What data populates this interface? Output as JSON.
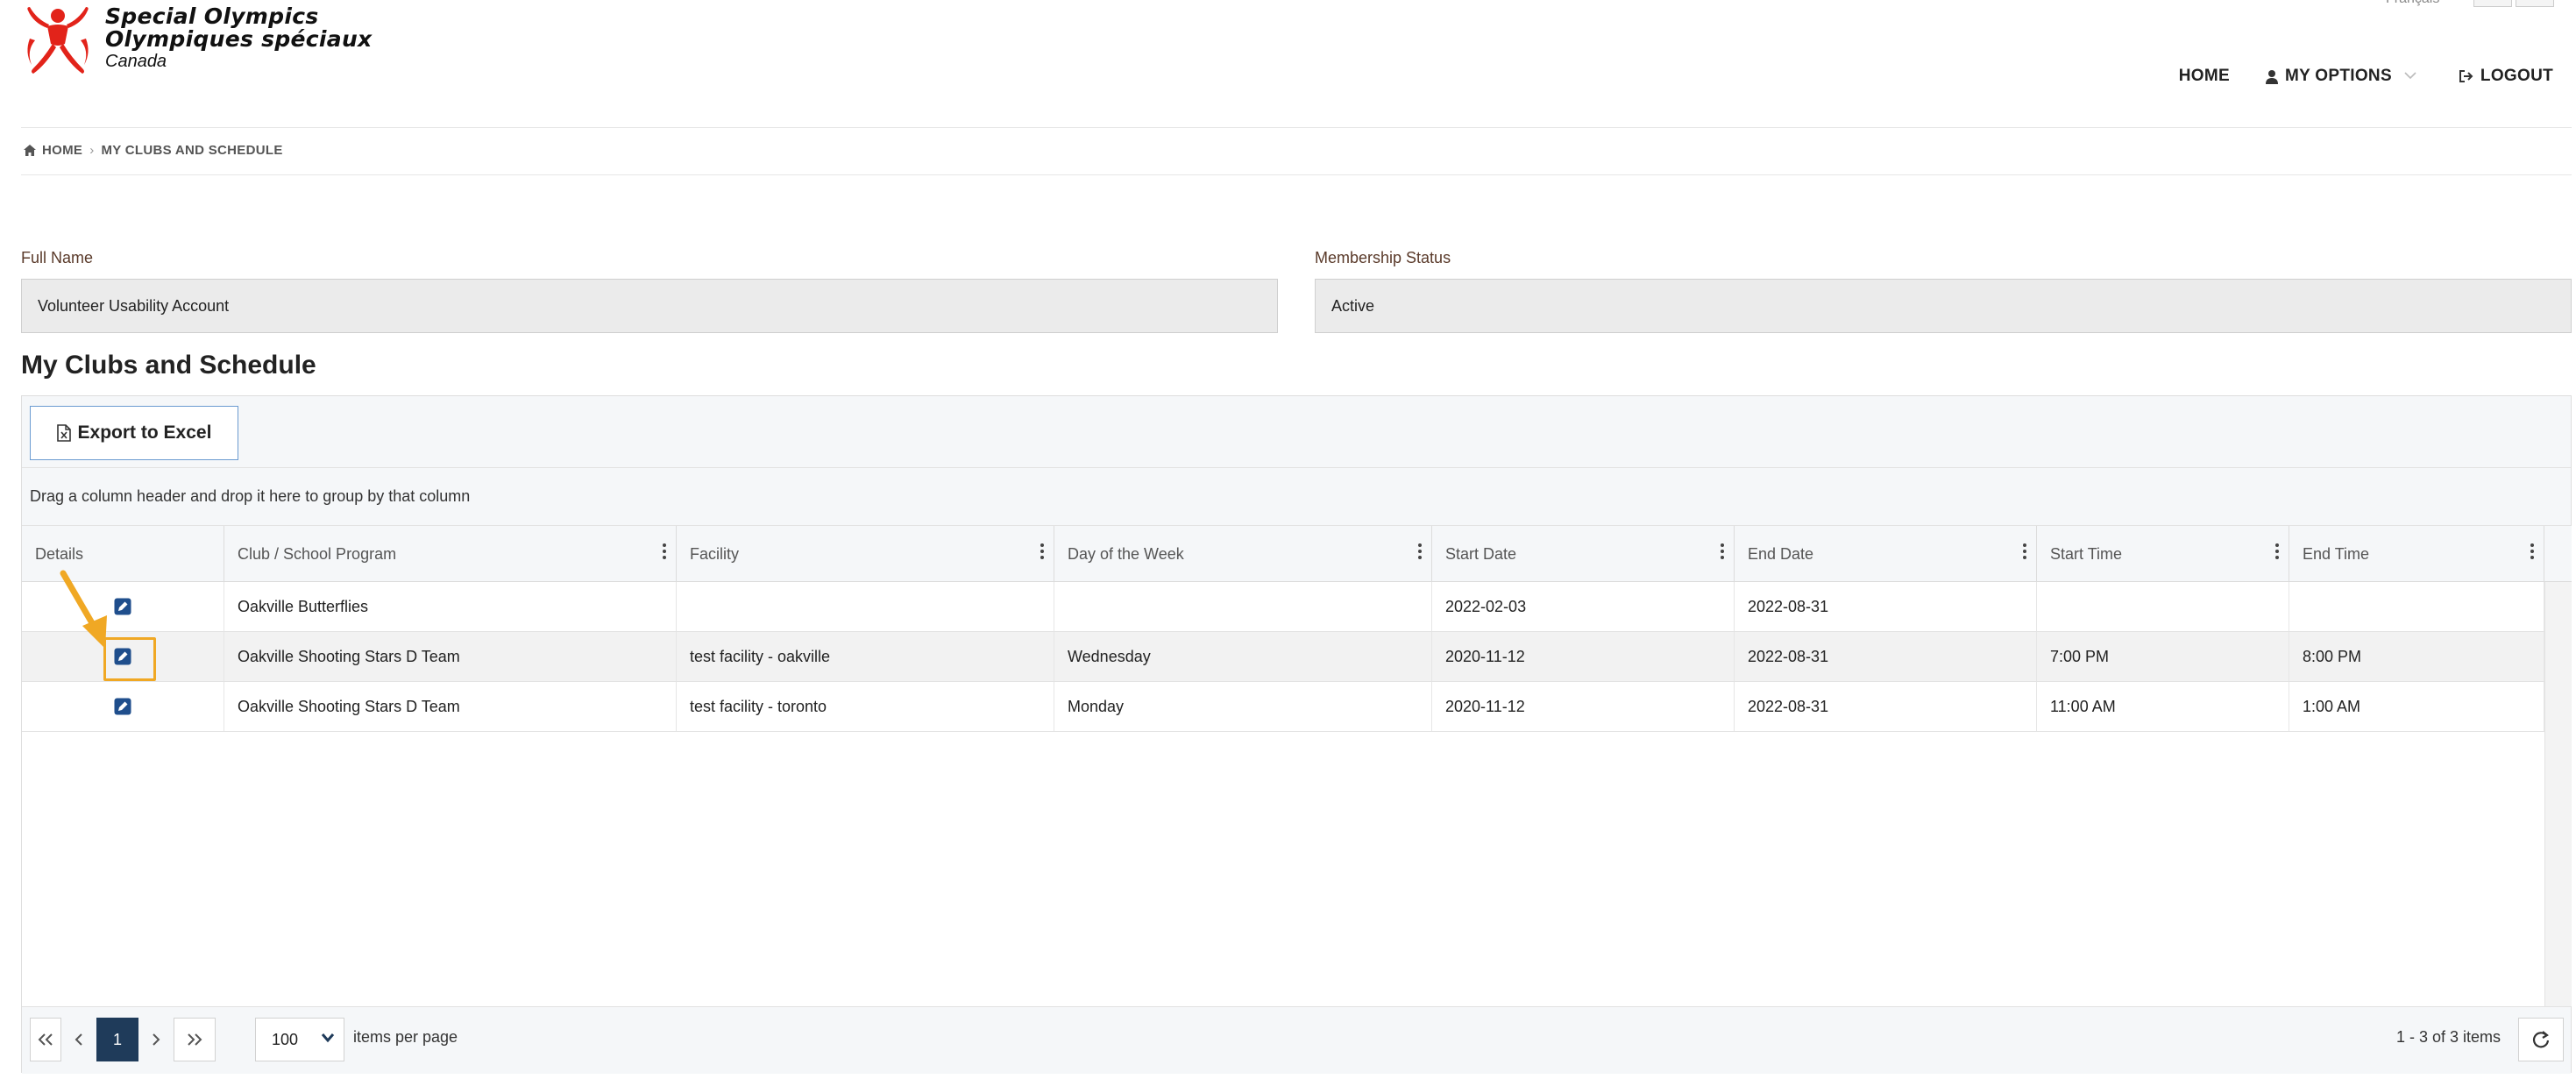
{
  "brand": {
    "line1": "Special Olympics",
    "line2": "Olympiques spéciaux",
    "line3": "Canada",
    "logo_color": "#e2231a"
  },
  "top_corner": {
    "language_link": "Français"
  },
  "nav": {
    "home": "HOME",
    "my_options": "MY OPTIONS",
    "logout": "LOGOUT"
  },
  "breadcrumb": {
    "home": "HOME",
    "current": "MY CLUBS AND SCHEDULE"
  },
  "profile": {
    "full_name_label": "Full Name",
    "full_name_value": "Volunteer Usability Account",
    "membership_label": "Membership Status",
    "membership_value": "Active"
  },
  "section_title": "My Clubs and Schedule",
  "grid": {
    "export_label": "Export to Excel",
    "group_hint": "Drag a column header and drop it here to group by that column",
    "columns": [
      {
        "label": "Details"
      },
      {
        "label": "Club / School Program"
      },
      {
        "label": "Facility"
      },
      {
        "label": "Day of the Week"
      },
      {
        "label": "Start Date"
      },
      {
        "label": "End Date"
      },
      {
        "label": "Start Time"
      },
      {
        "label": "End Time"
      }
    ],
    "rows": [
      {
        "club": "Oakville Butterflies",
        "facility": "",
        "day": "",
        "start_date": "2022-02-03",
        "end_date": "2022-08-31",
        "start_time": "",
        "end_time": ""
      },
      {
        "club": "Oakville Shooting Stars D Team",
        "facility": "test facility - oakville",
        "day": "Wednesday",
        "start_date": "2020-11-12",
        "end_date": "2022-08-31",
        "start_time": "7:00 PM",
        "end_time": "8:00 PM"
      },
      {
        "club": "Oakville Shooting Stars D Team",
        "facility": "test facility - toronto",
        "day": "Monday",
        "start_date": "2020-11-12",
        "end_date": "2022-08-31",
        "start_time": "11:00 AM",
        "end_time": "1:00 AM"
      }
    ]
  },
  "pager": {
    "current_page": "1",
    "page_size": "100",
    "items_per_page_label": "items per page",
    "info": "1 - 3 of 3 items"
  },
  "colors": {
    "accent_blue": "#1f3b5a",
    "highlight": "#f0a824",
    "edit_icon": "#1f4e8c"
  }
}
